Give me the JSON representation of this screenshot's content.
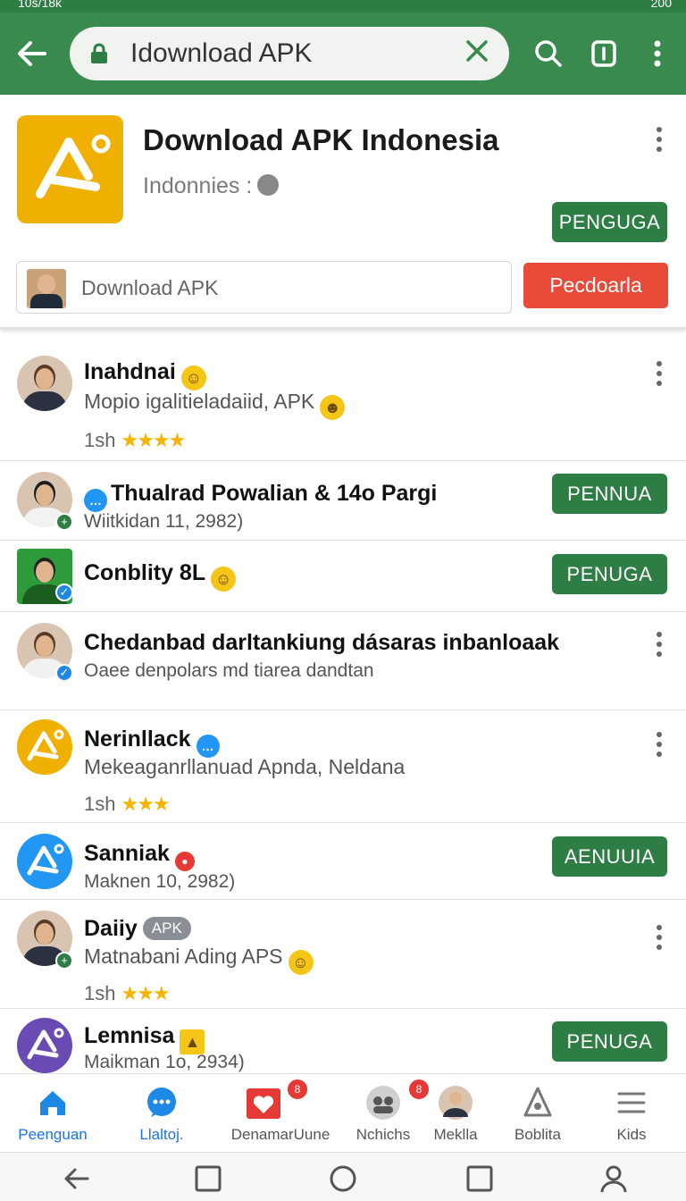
{
  "status_bar": {
    "left": "10s/18k",
    "right": "200"
  },
  "app_bar": {
    "url_text": "Idownload APK",
    "icons": {
      "back": "arrow-left-icon",
      "lock": "lock-icon",
      "clear": "close-icon",
      "search": "search-icon",
      "tabs": "tabs-icon",
      "menu": "more-vert-icon"
    }
  },
  "header": {
    "title": "Download APK Indonesia",
    "subtitle": "Indonnies :",
    "install_label": "PENGUGA",
    "download_input_value": "Download APK",
    "download_button_label": "Pecdoarla"
  },
  "items": [
    {
      "title": "Inahdnai",
      "subtitle": "Mopio igalitieladaiid,",
      "subtitle_suffix": "APK",
      "meta": "1sh",
      "stars": "★★★★"
    },
    {
      "title": "Thualrad Powalian & 14o Pargi",
      "subtitle": "Wiitkidan 11, 2982)",
      "button": "PENNUA"
    },
    {
      "title": "Conblity 8L",
      "button": "PENUGA"
    },
    {
      "title": "Chedanbad darltankiung dásaras inbanloaak",
      "subtitle": "Oaee denpolars md tiarea dandtan"
    },
    {
      "title": "Nerinllack",
      "subtitle": "Mekeaganrllanuad Apnda, Neldana",
      "meta": "1sh",
      "stars": "★★★"
    },
    {
      "title": "Sanniak",
      "subtitle": "Maknen 10, 2982)",
      "button": "AENUUIA"
    },
    {
      "title": "Daiiy",
      "tag": "APK",
      "subtitle": "Matnabani Ading APS",
      "meta": "1sh",
      "stars": "★★★"
    },
    {
      "title": "Lemnisa",
      "subtitle": "Maikman 1o, 2934)",
      "button": "PENUGA"
    }
  ],
  "bottom_nav": [
    {
      "label": "Peenguan",
      "icon": "home-icon",
      "active": true
    },
    {
      "label": "Llaltoj.",
      "icon": "chat-icon"
    },
    {
      "label": "DenamarUune",
      "icon": "heart-icon",
      "badge": "8"
    },
    {
      "label": "Nchichs",
      "icon": "people-icon",
      "badge": "8"
    },
    {
      "label": "Meklla",
      "icon": "profile-icon"
    },
    {
      "label": "Boblita",
      "icon": "app-logo-icon"
    },
    {
      "label": "Kids",
      "icon": "list-icon"
    }
  ],
  "system_nav": {
    "icons": [
      "back-icon",
      "recents-icon",
      "home-circle-icon",
      "square-icon",
      "user-icon"
    ]
  },
  "colors": {
    "primary_green": "#2e7d45",
    "appbar_green": "#3a8a4f",
    "accent_red": "#e84b3a",
    "logo_yellow": "#f0b000",
    "link_blue": "#1a73e8"
  }
}
